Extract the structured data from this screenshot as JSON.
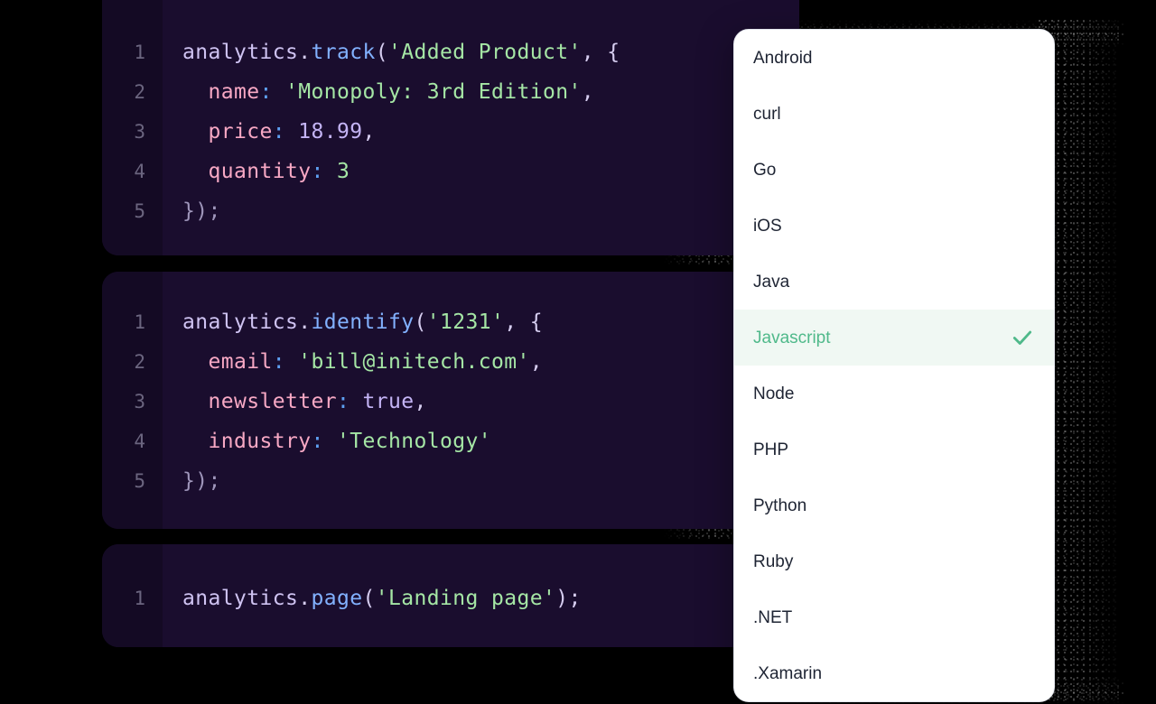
{
  "theme": {
    "page_background": "#000000",
    "code_card_background": "#1a0d2e",
    "code_gutter_background": "#140a24",
    "dropdown_background": "#ffffff",
    "dropdown_border": "#e2e5ec",
    "selected_row_background": "#f0f8f3",
    "selected_row_text": "#4fb98a",
    "accent_green": "#4fb98a",
    "syntax_identifier": "#cfc3f2",
    "syntax_function": "#82b1ff",
    "syntax_string": "#a5e6a5",
    "syntax_key": "#f7a8c4",
    "syntax_colon": "#5ea0f2",
    "syntax_number": "#c4b4f5",
    "syntax_punctuation": "#d6cdf0",
    "line_number": "#6b657f"
  },
  "code_blocks": [
    {
      "id": "track-snippet",
      "line_numbers": [
        "1",
        "2",
        "3",
        "4",
        "5"
      ],
      "lines": [
        {
          "id": "l1",
          "tokens": [
            {
              "text": "analytics",
              "cls": "t-id"
            },
            {
              "text": ".",
              "cls": "t-punc"
            },
            {
              "text": "track",
              "cls": "t-fn"
            },
            {
              "text": "(",
              "cls": "t-punc"
            },
            {
              "text": "'Added Product'",
              "cls": "t-str"
            },
            {
              "text": ", {",
              "cls": "t-punc"
            }
          ]
        },
        {
          "id": "l2",
          "tokens": [
            {
              "text": "  ",
              "cls": "t-punc"
            },
            {
              "text": "name",
              "cls": "t-key"
            },
            {
              "text": ":",
              "cls": "t-col"
            },
            {
              "text": " ",
              "cls": "t-punc"
            },
            {
              "text": "'Monopoly: 3rd Edition'",
              "cls": "t-str"
            },
            {
              "text": ",",
              "cls": "t-punc"
            }
          ]
        },
        {
          "id": "l3",
          "tokens": [
            {
              "text": "  ",
              "cls": "t-punc"
            },
            {
              "text": "price",
              "cls": "t-key"
            },
            {
              "text": ":",
              "cls": "t-col"
            },
            {
              "text": " ",
              "cls": "t-punc"
            },
            {
              "text": "18.99",
              "cls": "t-num"
            },
            {
              "text": ",",
              "cls": "t-punc"
            }
          ]
        },
        {
          "id": "l4",
          "tokens": [
            {
              "text": "  ",
              "cls": "t-punc"
            },
            {
              "text": "quantity",
              "cls": "t-key"
            },
            {
              "text": ":",
              "cls": "t-col"
            },
            {
              "text": " ",
              "cls": "t-punc"
            },
            {
              "text": "3",
              "cls": "t-grn"
            }
          ]
        },
        {
          "id": "l5",
          "tokens": [
            {
              "text": "});",
              "cls": "t-dim"
            }
          ]
        }
      ]
    },
    {
      "id": "identify-snippet",
      "line_numbers": [
        "1",
        "2",
        "3",
        "4",
        "5"
      ],
      "lines": [
        {
          "id": "l1",
          "tokens": [
            {
              "text": "analytics",
              "cls": "t-id"
            },
            {
              "text": ".",
              "cls": "t-punc"
            },
            {
              "text": "identify",
              "cls": "t-fn"
            },
            {
              "text": "(",
              "cls": "t-punc"
            },
            {
              "text": "'1231'",
              "cls": "t-str"
            },
            {
              "text": ", {",
              "cls": "t-punc"
            }
          ]
        },
        {
          "id": "l2",
          "tokens": [
            {
              "text": "  ",
              "cls": "t-punc"
            },
            {
              "text": "email",
              "cls": "t-key"
            },
            {
              "text": ":",
              "cls": "t-col"
            },
            {
              "text": " ",
              "cls": "t-punc"
            },
            {
              "text": "'bill@initech.com'",
              "cls": "t-str"
            },
            {
              "text": ",",
              "cls": "t-punc"
            }
          ]
        },
        {
          "id": "l3",
          "tokens": [
            {
              "text": "  ",
              "cls": "t-punc"
            },
            {
              "text": "newsletter",
              "cls": "t-key"
            },
            {
              "text": ":",
              "cls": "t-col"
            },
            {
              "text": " ",
              "cls": "t-punc"
            },
            {
              "text": "true",
              "cls": "t-lit"
            },
            {
              "text": ",",
              "cls": "t-punc"
            }
          ]
        },
        {
          "id": "l4",
          "tokens": [
            {
              "text": "  ",
              "cls": "t-punc"
            },
            {
              "text": "industry",
              "cls": "t-key"
            },
            {
              "text": ":",
              "cls": "t-col"
            },
            {
              "text": " ",
              "cls": "t-punc"
            },
            {
              "text": "'Technology'",
              "cls": "t-str"
            }
          ]
        },
        {
          "id": "l5",
          "tokens": [
            {
              "text": "});",
              "cls": "t-dim"
            }
          ]
        }
      ]
    },
    {
      "id": "page-snippet",
      "line_numbers": [
        "1"
      ],
      "lines": [
        {
          "id": "l1",
          "tokens": [
            {
              "text": "analytics",
              "cls": "t-id"
            },
            {
              "text": ".",
              "cls": "t-punc"
            },
            {
              "text": "page",
              "cls": "t-fn"
            },
            {
              "text": "(",
              "cls": "t-punc"
            },
            {
              "text": "'Landing page'",
              "cls": "t-str"
            },
            {
              "text": ");",
              "cls": "t-punc"
            }
          ]
        }
      ]
    }
  ],
  "language_dropdown": {
    "name": "language-selector",
    "selected": "Javascript",
    "check_icon": "check-icon",
    "items": [
      {
        "label": "Android",
        "selected": false
      },
      {
        "label": "curl",
        "selected": false
      },
      {
        "label": "Go",
        "selected": false
      },
      {
        "label": "iOS",
        "selected": false
      },
      {
        "label": "Java",
        "selected": false
      },
      {
        "label": "Javascript",
        "selected": true
      },
      {
        "label": "Node",
        "selected": false
      },
      {
        "label": "PHP",
        "selected": false
      },
      {
        "label": "Python",
        "selected": false
      },
      {
        "label": "Ruby",
        "selected": false
      },
      {
        "label": ".NET",
        "selected": false
      },
      {
        "label": ".Xamarin",
        "selected": false
      }
    ]
  }
}
